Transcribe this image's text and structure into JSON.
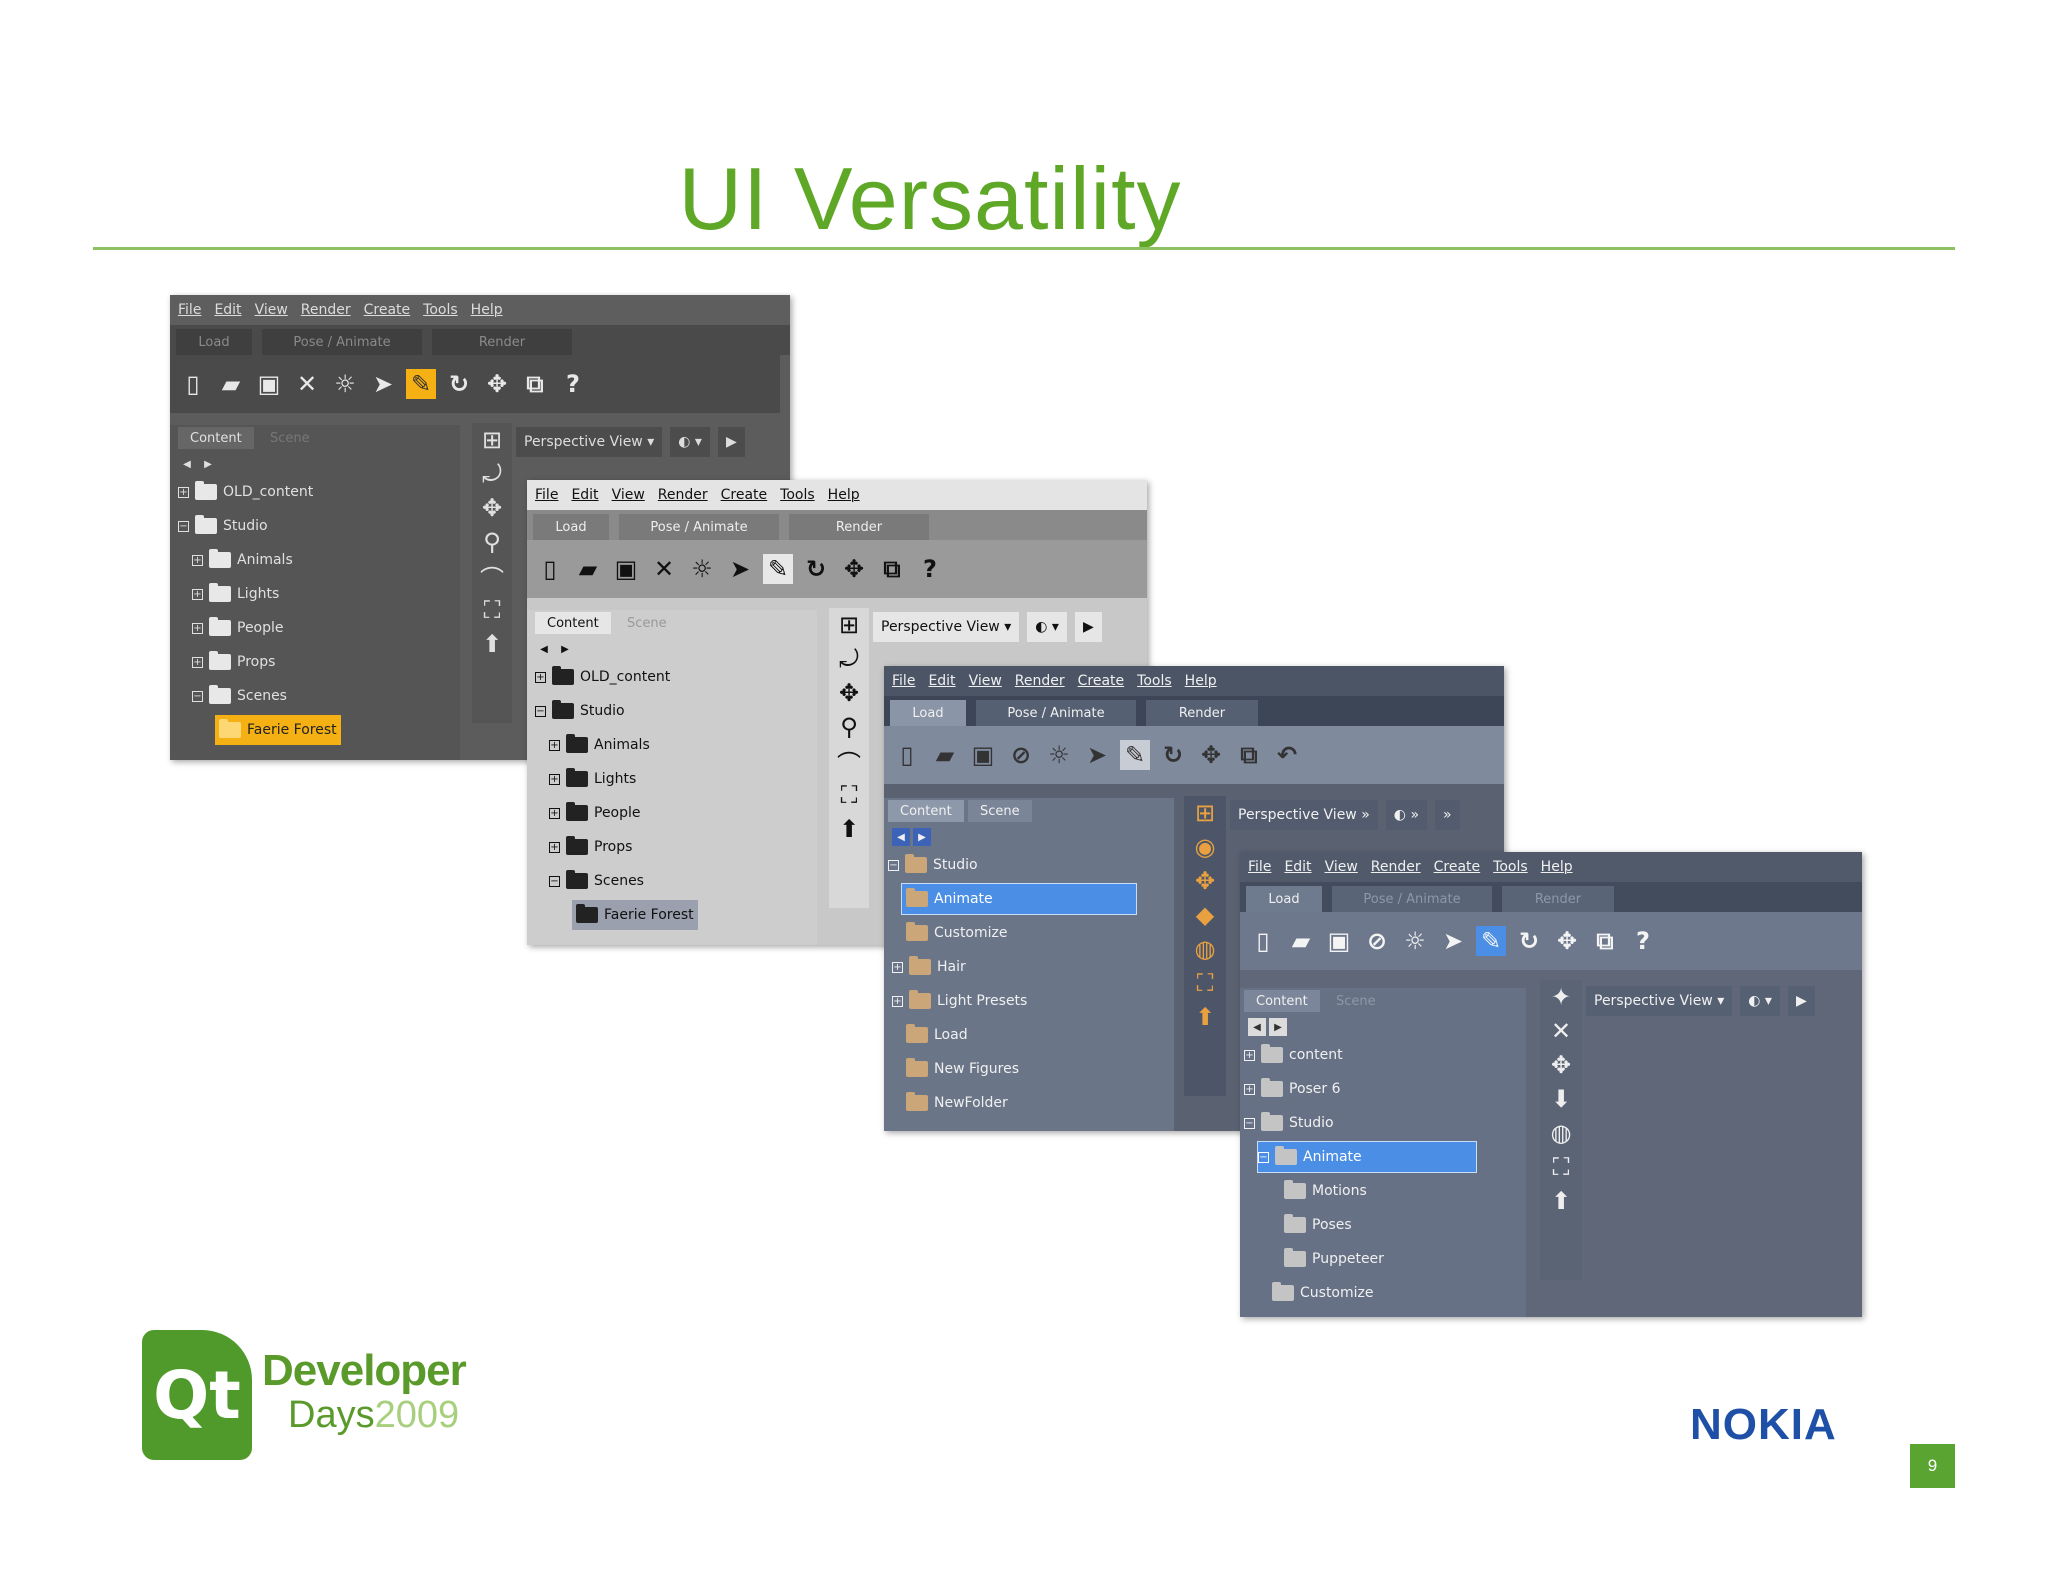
{
  "slide": {
    "title": "UI Versatility",
    "page_number": "9"
  },
  "menu": [
    "File",
    "Edit",
    "View",
    "Render",
    "Create",
    "Tools",
    "Help"
  ],
  "room_tabs": [
    "Load",
    "Pose / Animate",
    "Render"
  ],
  "panel_tabs": [
    "Content",
    "Scene"
  ],
  "view_label": "Perspective View",
  "window1": {
    "tree": [
      "OLD_content",
      "Studio",
      "Animals",
      "Lights",
      "People",
      "Props",
      "Scenes",
      "Faerie Forest"
    ]
  },
  "window2": {
    "tree": [
      "OLD_content",
      "Studio",
      "Animals",
      "Lights",
      "People",
      "Props",
      "Scenes",
      "Faerie Forest"
    ]
  },
  "window3": {
    "tree": [
      "Studio",
      "Animate",
      "Customize",
      "Hair",
      "Light Presets",
      "Load",
      "New Figures",
      "NewFolder"
    ]
  },
  "window4": {
    "tree": [
      "content",
      "Poser 6",
      "Studio",
      "Animate",
      "Motions",
      "Poses",
      "Puppeteer",
      "Customize"
    ]
  },
  "logos": {
    "qt": "Qt",
    "developer": "Developer",
    "days": "Days",
    "year": "2009",
    "nokia": "NOKIA"
  },
  "icons": {
    "toolbar": [
      "new-icon",
      "open-icon",
      "save-icon",
      "close-icon",
      "render-icon",
      "select-icon",
      "bone-icon",
      "rotate-icon",
      "move-icon",
      "scale-icon",
      "help-icon"
    ]
  },
  "colors": {
    "title": "#5fa827",
    "selection": "#4a8ee6",
    "dark_selection": "#f5b014"
  }
}
